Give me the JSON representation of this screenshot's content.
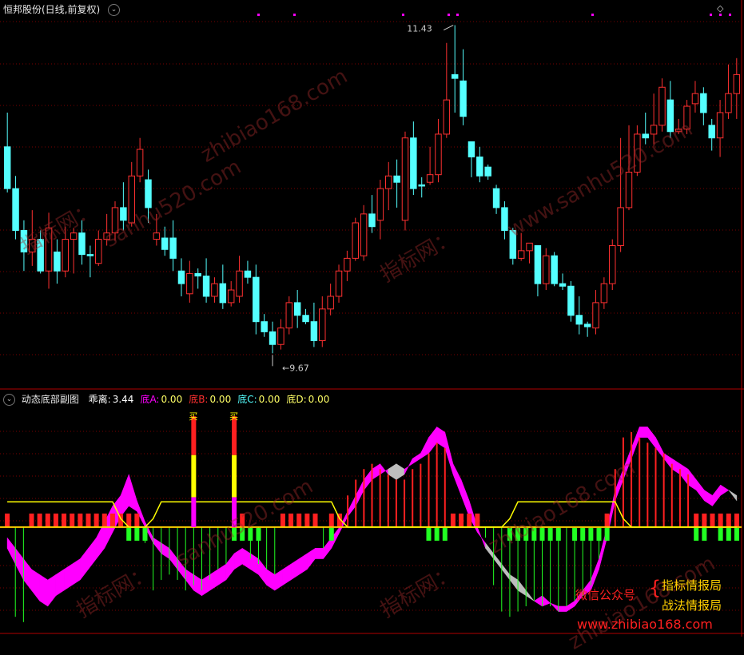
{
  "colors": {
    "up": "#ff3030",
    "down": "#54ffff",
    "grid": "#7a0000",
    "zero": "#ffd000",
    "magenta": "#ff00ff",
    "grey": "#bdbdbd",
    "green": "#22ff22",
    "yellow": "#ffff00",
    "red": "#ff2020"
  },
  "main_header": {
    "title": "恒邦股份(日线,前复权)",
    "settings_icon": "chevron-down-icon"
  },
  "sub_header": {
    "title": "动态底部副图",
    "items": [
      {
        "label": "乖离:",
        "value": "3.44",
        "color": "#ffffff"
      },
      {
        "label": "底A:",
        "value": "0.00",
        "color": "#ff00ff"
      },
      {
        "label": "底B:",
        "value": "0.00",
        "color": "#ff3030"
      },
      {
        "label": "底C:",
        "value": "0.00",
        "color": "#54ffff"
      },
      {
        "label": "底D:",
        "value": "0.00",
        "color": "#ffff66"
      }
    ]
  },
  "watermarks": [
    "zhibiao168.com",
    "sanhu520.com",
    "指标网：",
    "指标网：",
    "www.sanhu520.com",
    "zhibiao168.com",
    "sanhu520.com",
    "zhibiao168.com",
    "指标网：",
    "指标网："
  ],
  "promo": {
    "left": "微信公众号",
    "right1": "指标情报局",
    "right2": "战法情报局",
    "url": "www.zhibiao168.com"
  },
  "signal_char": "买",
  "chart_data": [
    {
      "type": "candlestick",
      "name": "price",
      "ylim": [
        8.9,
        11.8
      ],
      "annotations": [
        {
          "label": "11.43",
          "at": "max"
        },
        {
          "label": "9.67",
          "at": "min"
        }
      ],
      "candles": [
        [
          10.78,
          10.45,
          11.05,
          10.42
        ],
        [
          10.45,
          10.12,
          10.55,
          10.05
        ],
        [
          10.12,
          9.95,
          10.2,
          9.8
        ],
        [
          9.95,
          10.05,
          10.28,
          9.84
        ],
        [
          10.05,
          9.8,
          10.12,
          9.78
        ],
        [
          9.8,
          10.14,
          10.26,
          9.66
        ],
        [
          9.95,
          9.8,
          10.05,
          9.7
        ],
        [
          9.8,
          10.05,
          10.15,
          9.75
        ],
        [
          10.05,
          10.1,
          10.14,
          9.78
        ],
        [
          10.1,
          9.93,
          10.2,
          9.85
        ],
        [
          9.93,
          9.92,
          10.0,
          9.75
        ],
        [
          9.86,
          10.05,
          10.12,
          9.84
        ],
        [
          10.05,
          10.1,
          10.25,
          10.0
        ],
        [
          10.1,
          10.3,
          10.35,
          10.04
        ],
        [
          10.3,
          10.2,
          10.5,
          10.12
        ],
        [
          10.18,
          10.55,
          10.66,
          10.15
        ],
        [
          10.55,
          10.76,
          10.85,
          10.5
        ],
        [
          10.52,
          10.3,
          10.6,
          10.18
        ],
        [
          10.05,
          10.1,
          10.25,
          10.0
        ],
        [
          10.06,
          9.97,
          10.15,
          9.92
        ],
        [
          10.06,
          9.9,
          10.2,
          9.8
        ],
        [
          9.8,
          9.7,
          9.9,
          9.6
        ],
        [
          9.62,
          9.78,
          9.88,
          9.55
        ],
        [
          9.78,
          9.76,
          9.82,
          9.66
        ],
        [
          9.76,
          9.6,
          9.9,
          9.55
        ],
        [
          9.6,
          9.7,
          9.75,
          9.55
        ],
        [
          9.7,
          9.55,
          9.85,
          9.5
        ],
        [
          9.55,
          9.65,
          9.72,
          9.52
        ],
        [
          9.6,
          9.8,
          9.92,
          9.55
        ],
        [
          9.8,
          9.75,
          9.88,
          9.7
        ],
        [
          9.75,
          9.4,
          9.85,
          9.3
        ],
        [
          9.4,
          9.32,
          9.46,
          9.28
        ],
        [
          9.32,
          9.22,
          9.4,
          9.15
        ],
        [
          9.22,
          9.35,
          9.42,
          9.18
        ],
        [
          9.35,
          9.55,
          9.6,
          9.3
        ],
        [
          9.55,
          9.45,
          9.65,
          9.35
        ],
        [
          9.45,
          9.4,
          9.5,
          9.38
        ],
        [
          9.4,
          9.25,
          9.55,
          9.2
        ],
        [
          9.25,
          9.5,
          9.6,
          9.2
        ],
        [
          9.5,
          9.6,
          9.7,
          9.45
        ],
        [
          9.6,
          9.8,
          9.85,
          9.55
        ],
        [
          9.8,
          9.9,
          9.96,
          9.72
        ],
        [
          9.9,
          10.18,
          10.22,
          9.88
        ],
        [
          9.92,
          10.25,
          10.32,
          9.88
        ],
        [
          10.25,
          10.15,
          10.4,
          10.1
        ],
        [
          10.2,
          10.45,
          10.52,
          10.05
        ],
        [
          10.45,
          10.55,
          10.66,
          10.28
        ],
        [
          10.55,
          10.5,
          10.68,
          10.3
        ],
        [
          10.2,
          10.85,
          10.9,
          10.12
        ],
        [
          10.85,
          10.45,
          10.98,
          10.4
        ],
        [
          10.48,
          10.47,
          10.54,
          10.38
        ],
        [
          10.5,
          10.56,
          10.78,
          10.48
        ],
        [
          10.56,
          10.88,
          11.0,
          10.5
        ],
        [
          10.88,
          11.15,
          11.6,
          10.85
        ],
        [
          11.35,
          11.32,
          11.74,
          11.05
        ],
        [
          11.3,
          11.02,
          11.55,
          10.95
        ],
        [
          10.82,
          10.7,
          10.82,
          10.54
        ],
        [
          10.7,
          10.55,
          10.78,
          10.5
        ],
        [
          10.62,
          10.55,
          10.64,
          10.52
        ],
        [
          10.45,
          10.3,
          10.48,
          10.25
        ],
        [
          10.3,
          10.12,
          10.35,
          10.05
        ],
        [
          10.12,
          9.9,
          10.14,
          9.85
        ],
        [
          9.9,
          9.96,
          10.1,
          9.88
        ],
        [
          9.96,
          10.02,
          10.02,
          9.86
        ],
        [
          10.0,
          9.7,
          10.0,
          9.6
        ],
        [
          9.7,
          9.92,
          9.98,
          9.65
        ],
        [
          9.92,
          9.7,
          9.95,
          9.68
        ],
        [
          9.7,
          9.68,
          9.78,
          9.65
        ],
        [
          9.68,
          9.45,
          9.72,
          9.4
        ],
        [
          9.45,
          9.38,
          9.6,
          9.3
        ],
        [
          9.38,
          9.36,
          9.4,
          9.28
        ],
        [
          9.35,
          9.55,
          9.65,
          9.3
        ],
        [
          9.55,
          9.7,
          9.75,
          9.5
        ],
        [
          9.7,
          10.0,
          10.05,
          9.65
        ],
        [
          10.0,
          10.3,
          10.85,
          9.95
        ],
        [
          10.3,
          10.58,
          10.95,
          10.28
        ],
        [
          10.58,
          10.88,
          10.95,
          10.55
        ],
        [
          10.88,
          10.85,
          11.05,
          10.8
        ],
        [
          10.88,
          10.95,
          11.2,
          10.8
        ],
        [
          10.95,
          11.25,
          11.32,
          10.9
        ],
        [
          11.15,
          10.9,
          11.3,
          10.85
        ],
        [
          10.9,
          10.92,
          11.0,
          10.88
        ],
        [
          10.92,
          11.1,
          11.15,
          10.88
        ],
        [
          11.12,
          11.2,
          11.3,
          11.05
        ],
        [
          11.2,
          11.05,
          11.25,
          10.95
        ],
        [
          10.95,
          10.85,
          11.0,
          10.75
        ],
        [
          10.85,
          11.05,
          11.15,
          10.7
        ],
        [
          11.05,
          11.2,
          11.43,
          11.0
        ],
        [
          11.2,
          11.35,
          11.48,
          11.0
        ]
      ]
    },
    {
      "type": "indicator",
      "name": "动态底部副图",
      "ylim": [
        -1.0,
        1.15
      ],
      "zero": 0,
      "yellow_line": [
        0.24,
        0.24,
        0.24,
        0.24,
        0.24,
        0.24,
        0.24,
        0.24,
        0.24,
        0.24,
        0.24,
        0.24,
        0.24,
        0.24,
        0.08,
        0.0,
        0.0,
        0.0,
        0.08,
        0.24,
        0.24,
        0.24,
        0.24,
        0.24,
        0.24,
        0.24,
        0.24,
        0.24,
        0.24,
        0.24,
        0.24,
        0.24,
        0.24,
        0.24,
        0.24,
        0.24,
        0.24,
        0.24,
        0.24,
        0.24,
        0.24,
        0.08,
        0.0,
        0.0,
        0.0,
        0.0,
        0.0,
        0.0,
        0.0,
        0.0,
        0.0,
        0.0,
        0.0,
        0.0,
        0.0,
        0.0,
        0.0,
        0.0,
        0.0,
        0.0,
        0.0,
        0.0,
        0.08,
        0.24,
        0.24,
        0.24,
        0.24,
        0.24,
        0.24,
        0.24,
        0.24,
        0.24,
        0.24,
        0.24,
        0.24,
        0.24,
        0.08,
        0.0,
        0.0,
        0.0,
        0.0,
        0.0,
        0.0,
        0.0,
        0.0,
        0.0,
        0.0,
        0.0,
        0.0,
        0.0,
        0.0
      ],
      "upper_a": [
        -0.1,
        -0.2,
        -0.3,
        -0.4,
        -0.45,
        -0.5,
        -0.45,
        -0.4,
        -0.35,
        -0.3,
        -0.2,
        -0.1,
        0.05,
        0.2,
        0.3,
        0.5,
        0.25,
        0.05,
        -0.1,
        -0.15,
        -0.2,
        -0.3,
        -0.4,
        -0.45,
        -0.5,
        -0.45,
        -0.4,
        -0.35,
        -0.25,
        -0.2,
        -0.25,
        -0.3,
        -0.4,
        -0.45,
        -0.4,
        -0.35,
        -0.3,
        -0.25,
        -0.2,
        -0.2,
        -0.1,
        0.0,
        0.15,
        0.3,
        0.45,
        0.55,
        0.6,
        0.5,
        0.45,
        0.5,
        0.65,
        0.7,
        0.85,
        0.95,
        0.9,
        0.6,
        0.45,
        0.25,
        0.0,
        -0.2,
        -0.3,
        -0.4,
        -0.5,
        -0.6,
        -0.65,
        -0.7,
        -0.65,
        -0.72,
        -0.75,
        -0.75,
        -0.7,
        -0.6,
        -0.5,
        -0.3,
        0.0,
        0.35,
        0.55,
        0.75,
        0.95,
        0.95,
        0.85,
        0.7,
        0.65,
        0.6,
        0.55,
        0.45,
        0.35,
        0.3,
        0.4,
        0.35,
        0.25
      ],
      "lower_b": [
        -0.2,
        -0.35,
        -0.5,
        -0.6,
        -0.7,
        -0.75,
        -0.65,
        -0.6,
        -0.55,
        -0.5,
        -0.4,
        -0.3,
        -0.2,
        -0.05,
        0.1,
        0.2,
        0.15,
        0.0,
        -0.15,
        -0.25,
        -0.3,
        -0.4,
        -0.5,
        -0.6,
        -0.65,
        -0.6,
        -0.55,
        -0.5,
        -0.4,
        -0.35,
        -0.4,
        -0.45,
        -0.55,
        -0.6,
        -0.55,
        -0.5,
        -0.45,
        -0.4,
        -0.3,
        -0.3,
        -0.2,
        -0.05,
        0.1,
        0.2,
        0.35,
        0.45,
        0.5,
        0.55,
        0.6,
        0.55,
        0.6,
        0.65,
        0.7,
        0.8,
        0.75,
        0.5,
        0.3,
        0.1,
        -0.05,
        -0.15,
        -0.25,
        -0.35,
        -0.45,
        -0.5,
        -0.6,
        -0.7,
        -0.75,
        -0.72,
        -0.8,
        -0.8,
        -0.75,
        -0.65,
        -0.6,
        -0.4,
        -0.1,
        0.25,
        0.45,
        0.65,
        0.85,
        0.85,
        0.75,
        0.65,
        0.55,
        0.5,
        0.4,
        0.35,
        0.25,
        0.2,
        0.3,
        0.35,
        0.3
      ],
      "bars": [
        0.12,
        -0.85,
        -0.9,
        0.1,
        0.1,
        0.12,
        0.1,
        0.1,
        0.12,
        0.1,
        0.1,
        0.1,
        0.1,
        0.1,
        0.1,
        0.1,
        0.1,
        -0.15,
        -0.6,
        -0.5,
        -0.45,
        -0.5,
        -0.6,
        -0.55,
        -0.6,
        -0.5,
        -0.4,
        -0.35,
        0.1,
        0.1,
        -0.3,
        -0.35,
        -0.4,
        -0.45,
        0.1,
        0.1,
        0.1,
        0.1,
        0.1,
        -0.2,
        0.1,
        0.1,
        0.3,
        0.45,
        0.55,
        0.6,
        0.55,
        0.5,
        0.45,
        0.45,
        0.55,
        0.6,
        0.7,
        0.8,
        0.75,
        0.1,
        0.1,
        0.1,
        0.1,
        -0.1,
        -0.55,
        -0.8,
        -0.85,
        -0.8,
        -0.75,
        -0.7,
        -0.75,
        -0.75,
        -0.8,
        -0.75,
        -0.7,
        -0.65,
        -0.55,
        -0.3,
        0.1,
        0.55,
        0.85,
        0.9,
        0.85,
        0.8,
        0.75,
        0.7,
        0.6,
        0.55,
        0.5,
        0.1,
        0.1,
        0.1,
        0.1,
        0.1,
        0.12
      ],
      "signal_bars": [
        {
          "index": 23,
          "height": 1.05
        },
        {
          "index": 28,
          "height": 1.05
        }
      ],
      "green_blocks": [
        15,
        16,
        17,
        28,
        29,
        30,
        31,
        40,
        52,
        53,
        54,
        62,
        63,
        64,
        65,
        66,
        67,
        68,
        70,
        71,
        72,
        73,
        74,
        85,
        86,
        88,
        89,
        90
      ]
    }
  ]
}
